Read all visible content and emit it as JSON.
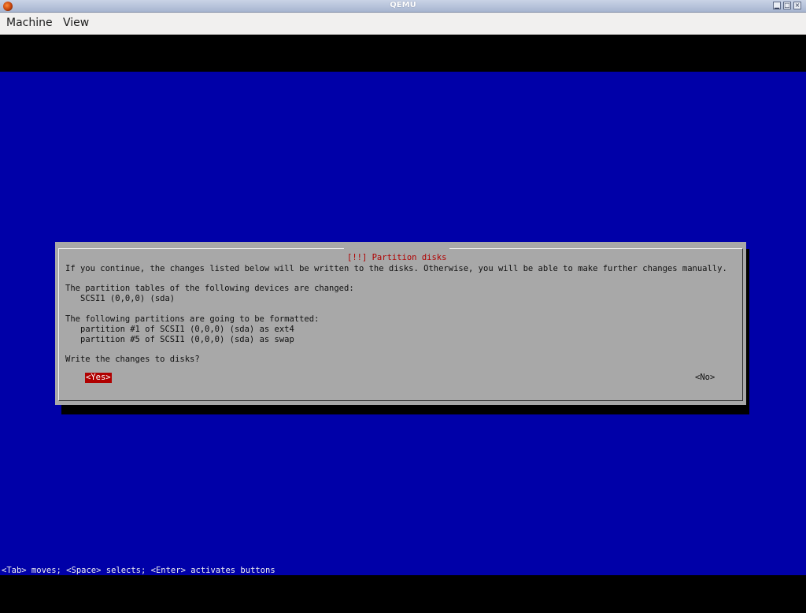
{
  "window": {
    "title": "QEMU",
    "controls": {
      "minimize_glyph": "▁",
      "maximize_glyph": "□",
      "close_glyph": "×"
    }
  },
  "menubar": {
    "items": [
      {
        "label": "Machine"
      },
      {
        "label": "View"
      }
    ]
  },
  "colors": {
    "screen_bg": "#0000a8",
    "dialog_bg": "#a8a8a8",
    "dialog_title": "#b00000",
    "selected_button_bg": "#b00000"
  },
  "dialog": {
    "title": "[!!] Partition disks",
    "lines": {
      "intro": "If you continue, the changes listed below will be written to the disks. Otherwise, you will be able to make further changes manually.",
      "tables_header": "The partition tables of the following devices are changed:",
      "tables_device": "SCSI1 (0,0,0) (sda)",
      "format_header": "The following partitions are going to be formatted:",
      "format_part1": "partition #1 of SCSI1 (0,0,0) (sda) as ext4",
      "format_part5": "partition #5 of SCSI1 (0,0,0) (sda) as swap",
      "question": "Write the changes to disks?"
    },
    "buttons": {
      "yes": "<Yes>",
      "no": "<No>",
      "selected": "yes"
    }
  },
  "help_line": "<Tab> moves; <Space> selects; <Enter> activates buttons"
}
